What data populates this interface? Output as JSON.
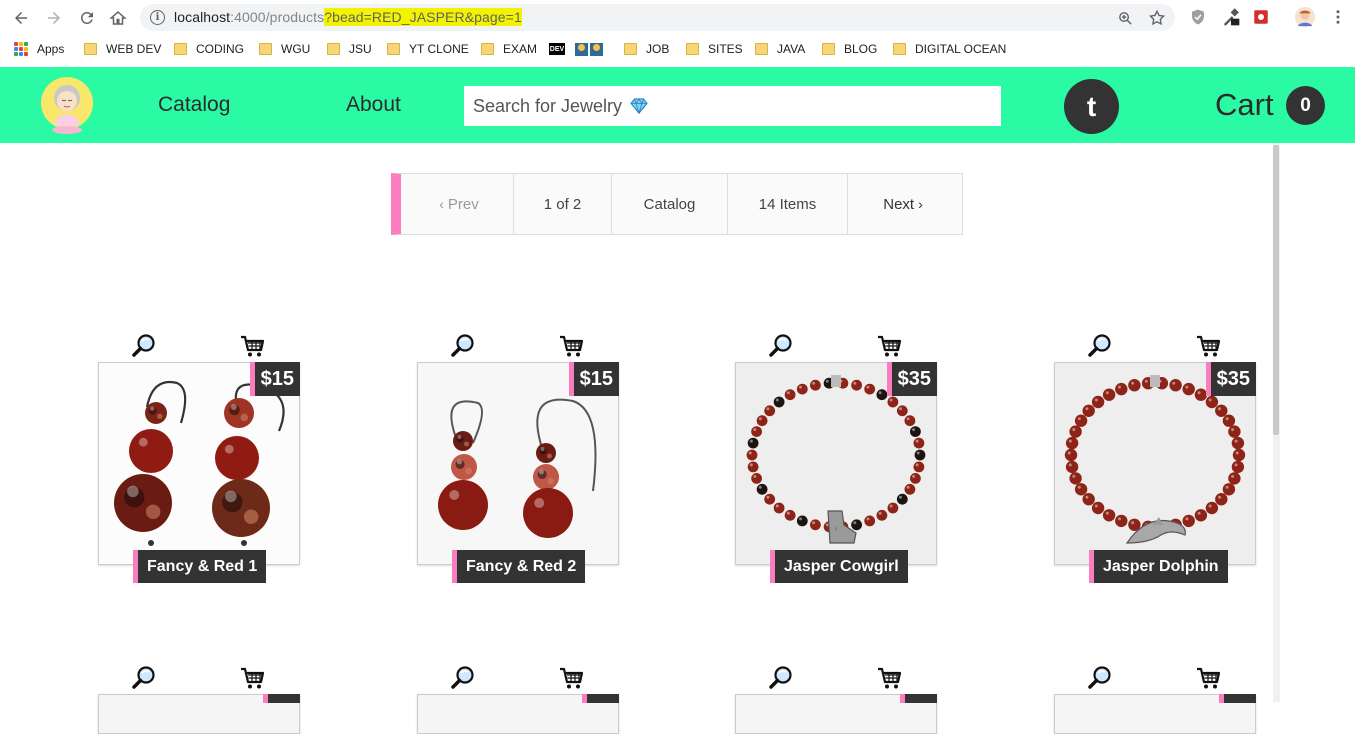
{
  "browser": {
    "url_host": "localhost",
    "url_port_path": ":4000/products",
    "url_query": "?bead=RED_JASPER&page=1",
    "bookmarks": [
      {
        "label": "Apps",
        "kind": "apps"
      },
      {
        "label": "WEB DEV",
        "kind": "folder"
      },
      {
        "label": "CODING",
        "kind": "folder"
      },
      {
        "label": "WGU",
        "kind": "folder"
      },
      {
        "label": "JSU",
        "kind": "folder"
      },
      {
        "label": "YT CLONE",
        "kind": "folder"
      },
      {
        "label": "EXAM",
        "kind": "folder"
      },
      {
        "label": "",
        "kind": "dev"
      },
      {
        "label": "",
        "kind": "emoji"
      },
      {
        "label": "JOB",
        "kind": "folder"
      },
      {
        "label": "SITES",
        "kind": "folder"
      },
      {
        "label": "JAVA",
        "kind": "folder"
      },
      {
        "label": "BLOG",
        "kind": "folder"
      },
      {
        "label": "DIGITAL OCEAN",
        "kind": "folder"
      }
    ]
  },
  "header": {
    "nav_catalog": "Catalog",
    "nav_about": "About",
    "search_placeholder": "Search for Jewelry",
    "avatar_letter": "t",
    "cart_label": "Cart",
    "cart_count": "0"
  },
  "pagination": {
    "prev": "Prev",
    "page_info": "1 of 2",
    "catalog": "Catalog",
    "items": "14 Items",
    "next": "Next"
  },
  "products": [
    {
      "name": "Fancy & Red 1",
      "price": "$15",
      "kind": "earrings-a"
    },
    {
      "name": "Fancy & Red 2",
      "price": "$15",
      "kind": "earrings-b"
    },
    {
      "name": "Jasper Cowgirl",
      "price": "$35",
      "kind": "bracelet-boot"
    },
    {
      "name": "Jasper Dolphin",
      "price": "$35",
      "kind": "bracelet-dolphin"
    }
  ],
  "colors": {
    "header_bg": "#2bfaa5",
    "accent_pink": "#fc7dbf",
    "dark": "#333333",
    "url_highlight": "#f3f300"
  }
}
